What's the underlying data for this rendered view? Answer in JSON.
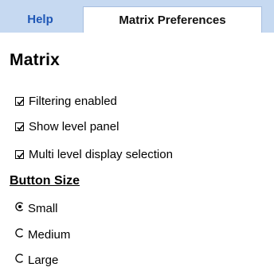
{
  "tabs": [
    {
      "label": "Help",
      "selected": false
    },
    {
      "label": "Matrix Preferences",
      "selected": true
    }
  ],
  "section": {
    "title": "Matrix"
  },
  "checkboxes": [
    {
      "label": "Filtering enabled",
      "checked": true
    },
    {
      "label": "Show level panel",
      "checked": true
    },
    {
      "label": "Multi level display selection",
      "checked": true
    }
  ],
  "button_size": {
    "heading": "Button Size",
    "options": [
      {
        "label": "Small",
        "selected": true
      },
      {
        "label": "Medium",
        "selected": false
      },
      {
        "label": "Large",
        "selected": false
      }
    ]
  },
  "colors": {
    "tabbar_bg": "#c6d9f1",
    "help_tab_text": "#1f57b6"
  }
}
